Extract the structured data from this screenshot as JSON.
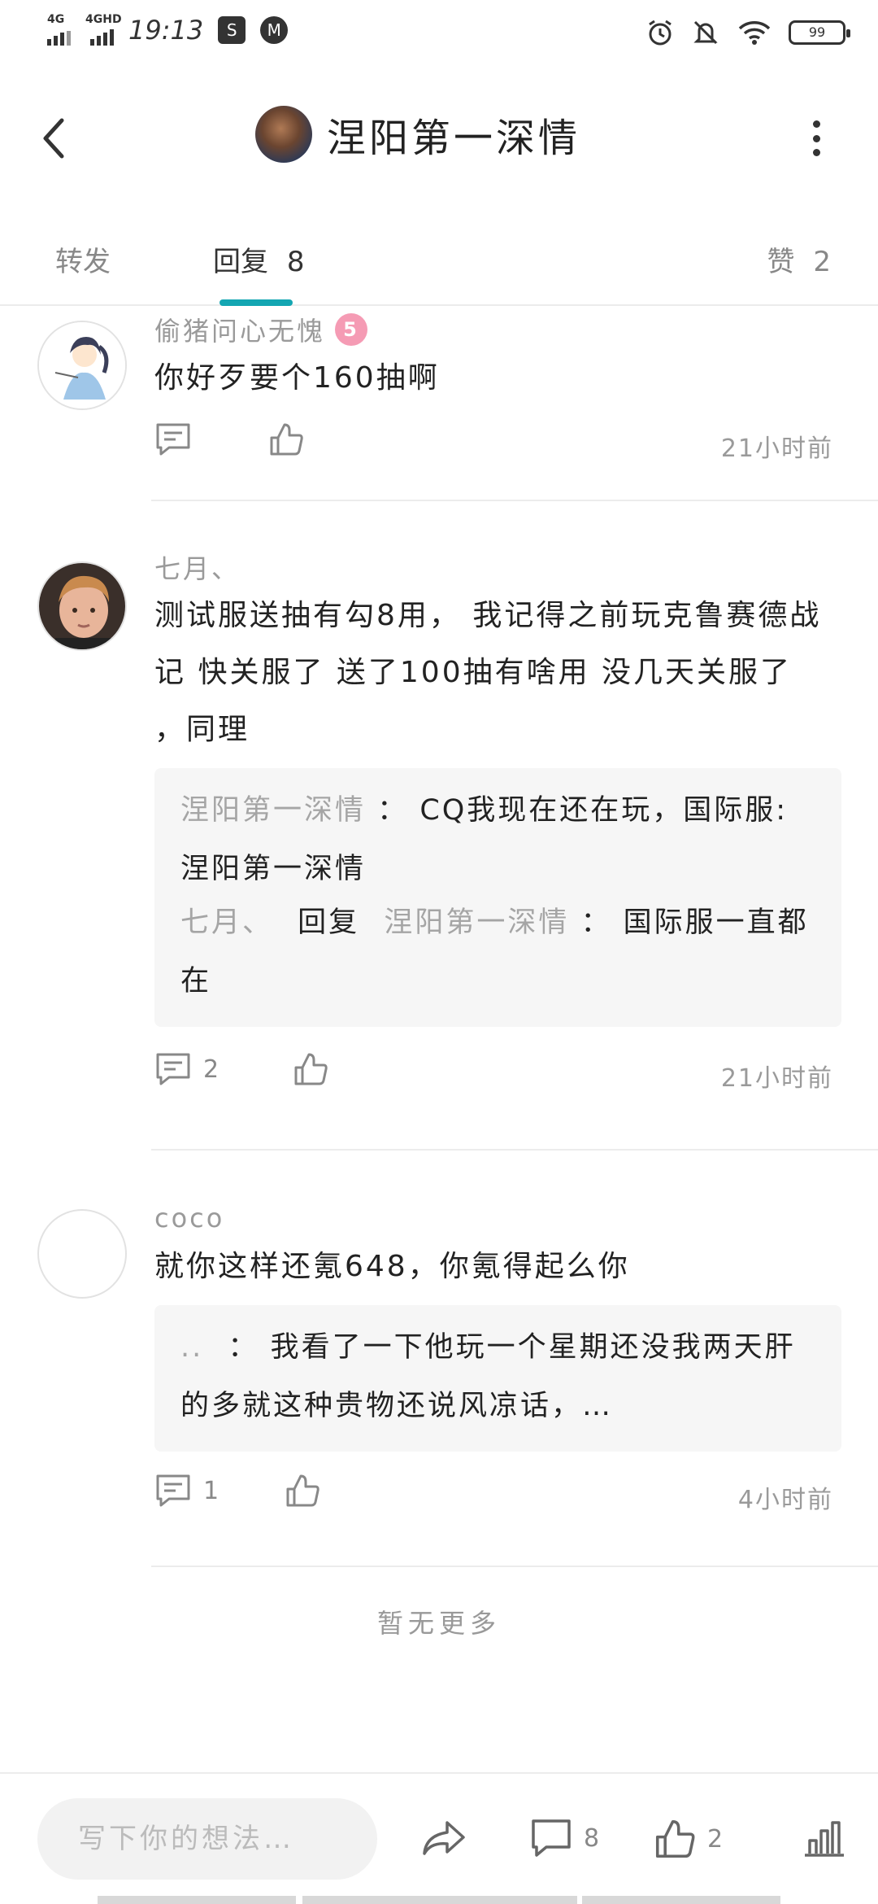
{
  "status_bar": {
    "signal1": "4G",
    "signal2": "4GHD",
    "time": "19:13",
    "battery": "99"
  },
  "header": {
    "title": "涅阳第一深情"
  },
  "tabs": {
    "repost": "转发",
    "reply_label": "回复",
    "reply_count": "8",
    "like_label": "赞",
    "like_count": "2"
  },
  "comments": [
    {
      "name": "偷猪问心无愧",
      "level": "5",
      "text": "你好歹要个160抽啊",
      "reply_count": "",
      "time": "21小时前"
    },
    {
      "name": "七月、",
      "text": "测试服送抽有勾8用，      我记得之前玩克鲁赛德战记      快关服了   送了100抽有啥用     没几天关服了       ，同理",
      "quotes": [
        {
          "name": "涅阳第一深情",
          "sep": "：",
          "text": "CQ我现在还在玩，国际服:涅阳第一深情"
        },
        {
          "name": "七月、",
          "reply_word": "回复",
          "target": "涅阳第一深情",
          "sep": "：",
          "text": "国际服一直都在"
        }
      ],
      "reply_count": "2",
      "time": "21小时前"
    },
    {
      "name": "coco",
      "text": "就你这样还氪648，你氪得起么你",
      "quotes": [
        {
          "name": "..",
          "sep": "：",
          "text": "我看了一下他玩一个星期还没我两天肝的多就这种贵物还说风凉话，…"
        }
      ],
      "reply_count": "1",
      "time": "4小时前"
    }
  ],
  "no_more": "暂无更多",
  "bottom_bar": {
    "input_placeholder": "写下你的想法…",
    "comment_count": "8",
    "like_count": "2"
  },
  "colors": {
    "accent": "#14a6b2",
    "level_badge": "#f59bb4",
    "muted_text": "#9a9a9a"
  }
}
